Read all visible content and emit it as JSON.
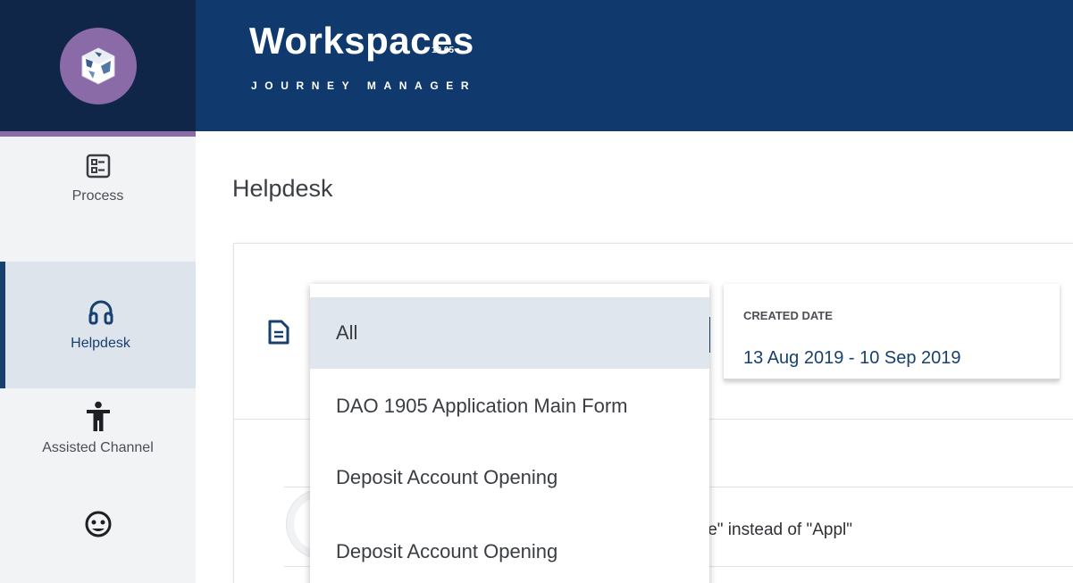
{
  "header": {
    "title": "Workspaces",
    "version": "19.05",
    "subtitle": "JOURNEY MANAGER"
  },
  "sidebar": {
    "items": [
      {
        "label": "Process",
        "icon": "process-list-icon"
      },
      {
        "label": "Helpdesk",
        "icon": "headset-icon",
        "active": true
      },
      {
        "label": "Assisted Channel",
        "icon": "person-icon"
      },
      {
        "label": "",
        "icon": "face-icon"
      }
    ]
  },
  "main": {
    "title": "Helpdesk"
  },
  "filter": {
    "created_date_label": "CREATED DATE",
    "created_date_value": "13 Aug 2019 - 10 Sep 2019"
  },
  "dropdown": {
    "options": [
      "All",
      "DAO 1905 Application Main Form",
      "Deposit Account Opening",
      "Deposit Account Opening"
    ],
    "selected": "All"
  },
  "result": {
    "text": "le\" instead of \"Appl\""
  },
  "colors": {
    "header_bg": "#103a6e",
    "logo_bg": "#0f2649",
    "accent_purple": "#8b6aa8",
    "primary_blue": "#17406f",
    "sidebar_bg": "#f2f3f5",
    "selected_bg": "#dfe6ee"
  }
}
